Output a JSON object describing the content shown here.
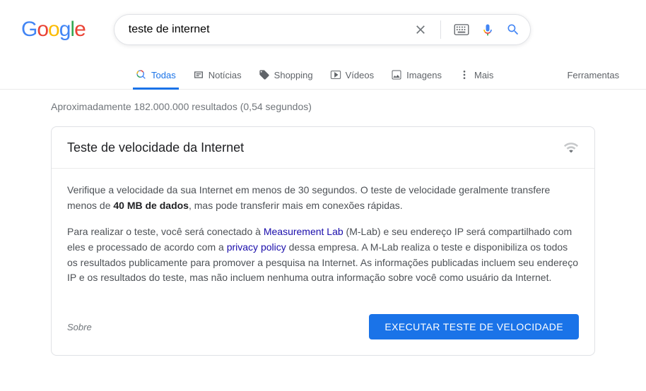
{
  "logo": {
    "g1": "G",
    "o1": "o",
    "o2": "o",
    "g2": "g",
    "l": "l",
    "e": "e"
  },
  "search": {
    "value": "teste de internet"
  },
  "tabs": {
    "all": "Todas",
    "news": "Notícias",
    "shopping": "Shopping",
    "videos": "Vídeos",
    "images": "Imagens",
    "more": "Mais"
  },
  "tools": "Ferramentas",
  "results_stats": "Aproximadamente 182.000.000 resultados (0,54 segundos)",
  "card": {
    "title": "Teste de velocidade da Internet",
    "para1_a": "Verifique a velocidade da sua Internet em menos de 30 segundos. O teste de velocidade geralmente transfere menos de ",
    "para1_bold": "40 MB de dados",
    "para1_b": ", mas pode transferir mais em conexões rápidas.",
    "para2_a": "Para realizar o teste, você será conectado à ",
    "link1": "Measurement Lab",
    "para2_b": " (M-Lab) e seu endereço IP será compartilhado com eles e processado de acordo com a ",
    "link2": "privacy policy",
    "para2_c": " dessa empresa. A M-Lab realiza o teste e disponibiliza os todos os resultados publicamente para promover a pesquisa na Internet. As informações publicadas incluem seu endereço IP e os resultados do teste, mas não incluem nenhuma outra informação sobre você como usuário da Internet.",
    "sobre": "Sobre",
    "button": "EXECUTAR TESTE DE VELOCIDADE"
  }
}
